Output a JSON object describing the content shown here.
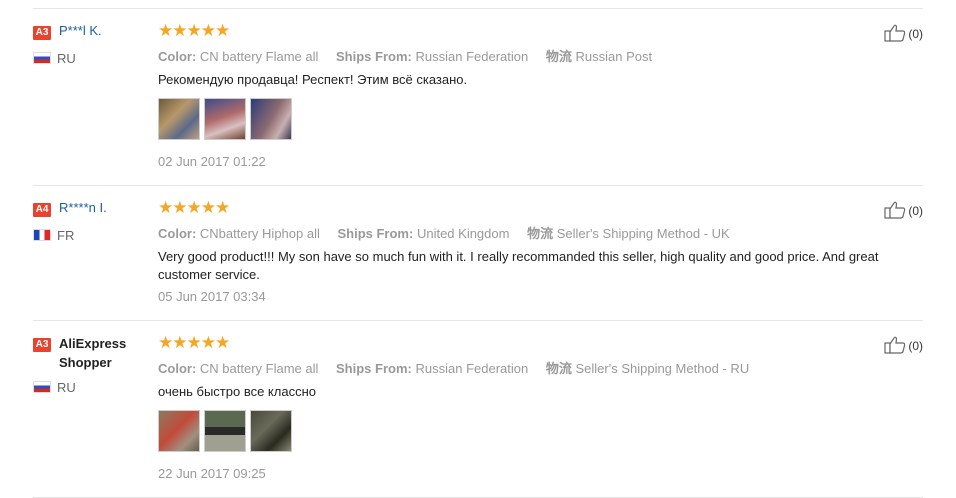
{
  "labels": {
    "color": "Color:",
    "ships_from": "Ships From:",
    "logistics": "物流"
  },
  "reviews": [
    {
      "badge": "A3",
      "name": "P***l K.",
      "country": "RU",
      "stars": "★★★★★",
      "color": "CN battery Flame all",
      "ships_from": "Russian Federation",
      "logistics": "Russian Post",
      "text": "Рекомендую продавца! Респект! Этим всё сказано.",
      "photos": [
        "photo-1",
        "photo-2",
        "photo-3"
      ],
      "date": "02 Jun 2017 01:22",
      "helpful": "(0)"
    },
    {
      "badge": "A4",
      "name": "R****n I.",
      "country": "FR",
      "stars": "★★★★★",
      "color": "CNbattery Hiphop all",
      "ships_from": "United Kingdom",
      "logistics": "Seller's Shipping Method - UK",
      "text": "Very good product!!! My son have so much fun with it. I really recommanded this seller, high quality and good price. And great customer service.",
      "photos": [],
      "date": "05 Jun 2017 03:34",
      "helpful": "(0)"
    },
    {
      "badge": "A3",
      "name": "AliExpress Shopper",
      "country": "RU",
      "stars": "★★★★★",
      "color": "CN battery Flame all",
      "ships_from": "Russian Federation",
      "logistics": "Seller's Shipping Method - RU",
      "text": "очень быстро все классно",
      "photos": [
        "photo-1",
        "photo-2",
        "photo-3"
      ],
      "date": "22 Jun 2017 09:25",
      "helpful": "(0)"
    }
  ],
  "colors": {
    "badge": "#e8442d",
    "stars": "#f5a623",
    "name_link": "#1a5ea0",
    "meta": "#999999"
  }
}
